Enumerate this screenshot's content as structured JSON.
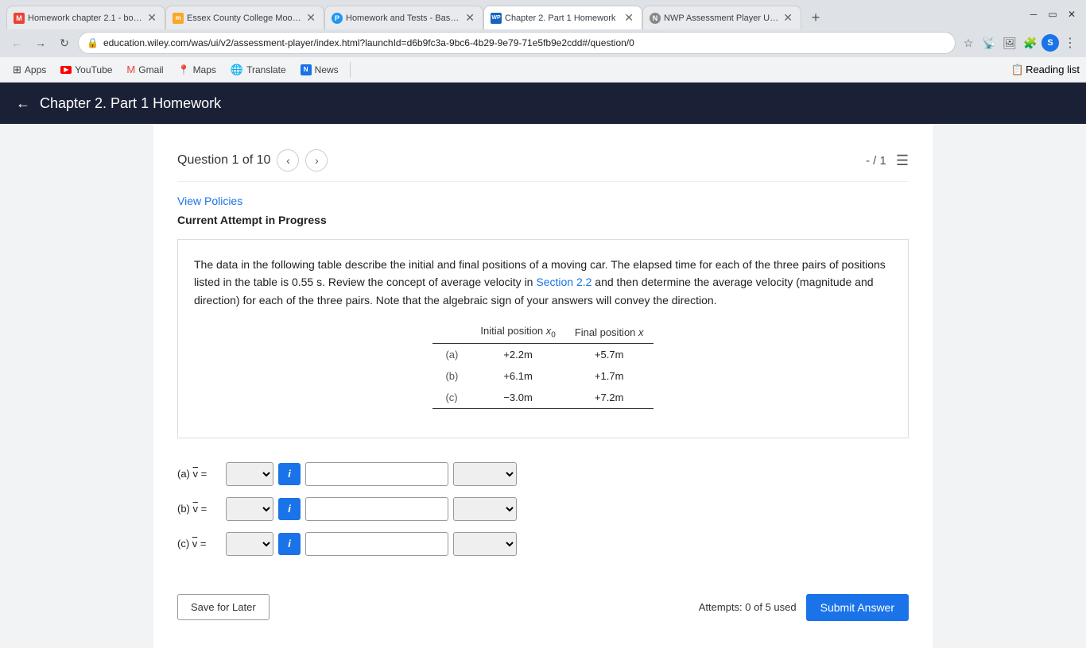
{
  "browser": {
    "tabs": [
      {
        "id": 1,
        "icon": "M",
        "icon_color": "#ea4335",
        "title": "Homework chapter 2.1 - bok...",
        "active": false
      },
      {
        "id": 2,
        "icon": "m",
        "icon_color": "#f9a825",
        "title": "Essex County College Moodl...",
        "active": false
      },
      {
        "id": 3,
        "icon": "P",
        "icon_color": "#2196f3",
        "title": "Homework and Tests - Basile...",
        "active": false
      },
      {
        "id": 4,
        "icon": "WP",
        "icon_color": "#1565c0",
        "title": "Chapter 2. Part 1 Homework",
        "active": true
      },
      {
        "id": 5,
        "icon": "N",
        "icon_color": "#888",
        "title": "NWP Assessment Player UI A...",
        "active": false
      }
    ],
    "url": "education.wiley.com/was/ui/v2/assessment-player/index.html?launchId=d6b9fc3a-9bc6-4b29-9e79-71e5fb9e2cdd#/question/0",
    "bookmarks": [
      {
        "label": "Apps",
        "icon": "⊞"
      },
      {
        "label": "YouTube",
        "icon_color": "#ff0000"
      },
      {
        "label": "Gmail",
        "icon": "M"
      },
      {
        "label": "Maps",
        "icon": "📍"
      },
      {
        "label": "Translate",
        "icon": "🌐"
      },
      {
        "label": "News",
        "icon_color": "#1a73e8"
      }
    ],
    "reading_list": "Reading list"
  },
  "page_header": {
    "back_label": "←",
    "title": "Chapter 2. Part 1 Homework"
  },
  "question": {
    "nav_label": "Question 1 of 10",
    "score": "- / 1",
    "view_policies": "View Policies",
    "attempt_status": "Current Attempt in Progress",
    "text_part1": "The data in the following table describe the initial and final positions of a moving car. The elapsed time for each of the three pairs of positions listed in the table is 0.55 s. Review the concept of average velocity in ",
    "section_link_text": "Section 2.2",
    "text_part2": " and then determine the average velocity (magnitude and direction) for each of the three pairs. Note that the algebraic sign of your answers will convey the direction.",
    "table": {
      "col1_header": "Initial position x₀",
      "col2_header": "Final position x",
      "rows": [
        {
          "label": "(a)",
          "initial": "+2.2m",
          "final": "+5.7m"
        },
        {
          "label": "(b)",
          "initial": "+6.1m",
          "final": "+1.7m"
        },
        {
          "label": "(c)",
          "initial": "−3.0m",
          "final": "+7.2m"
        }
      ]
    },
    "answer_rows": [
      {
        "id": "a",
        "label_html": "(a) v̄ ="
      },
      {
        "id": "b",
        "label_html": "(b) v̄ ="
      },
      {
        "id": "c",
        "label_html": "(c) v̄ ="
      }
    ],
    "save_later": "Save for Later",
    "attempts_text": "Attempts: 0 of 5 used",
    "submit": "Submit Answer"
  }
}
